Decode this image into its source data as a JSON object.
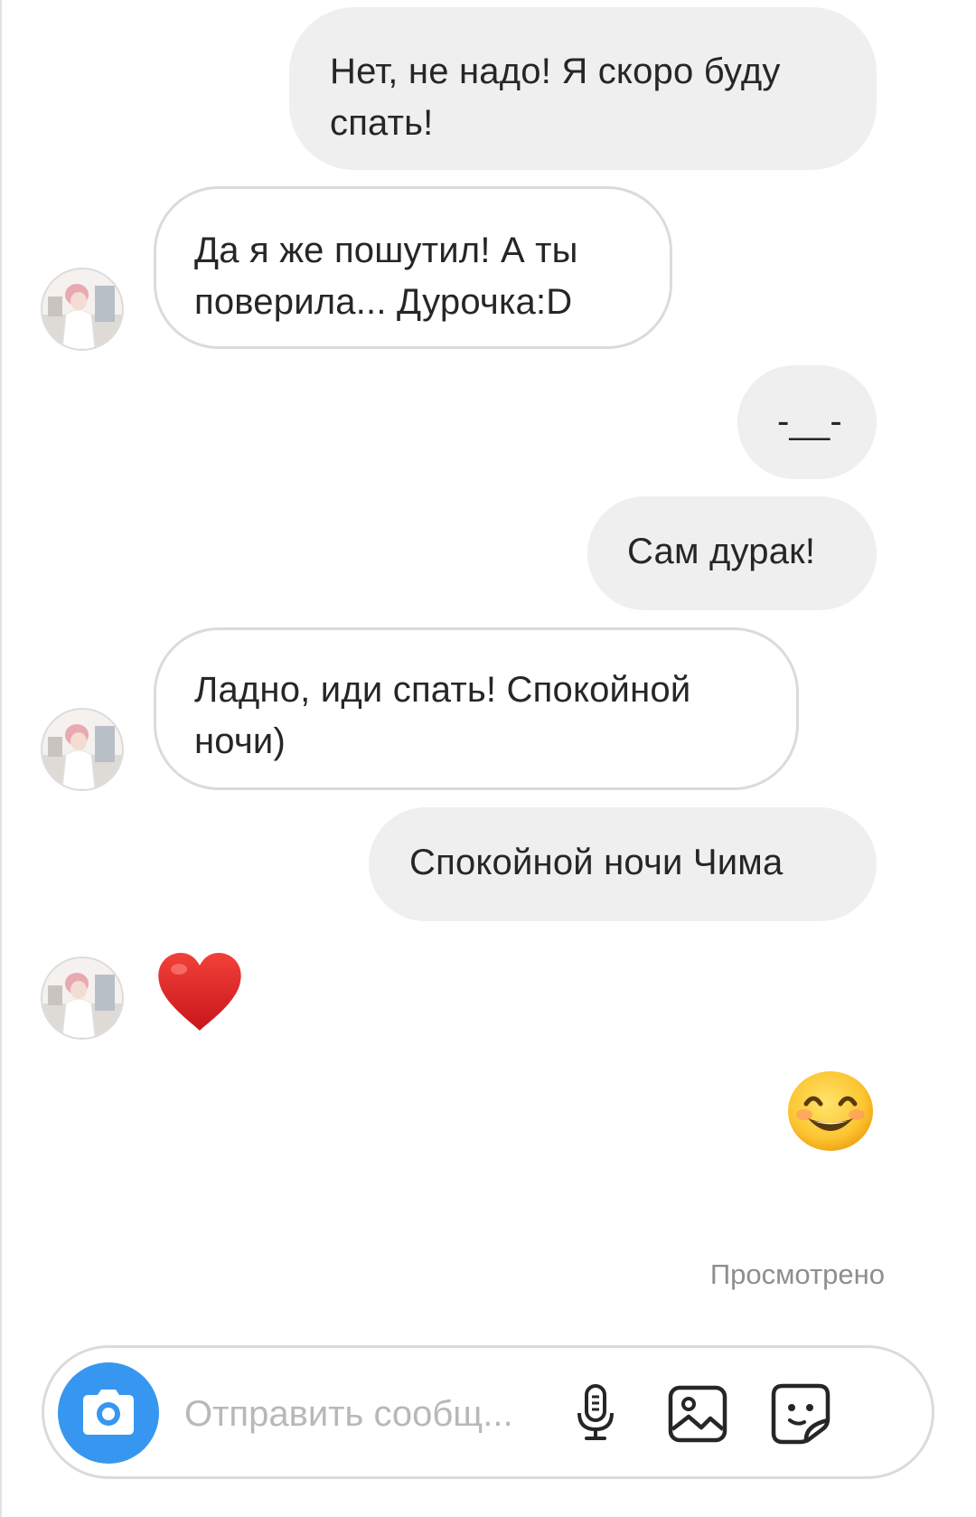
{
  "messages": [
    {
      "side": "sent",
      "text": "Нет, не надо! Я скоро буду спать!"
    },
    {
      "side": "received",
      "text": "Да я же пошутил! А ты поверила... Дурочка:D"
    },
    {
      "side": "sent",
      "text": "-__-"
    },
    {
      "side": "sent",
      "text": "Сам дурак!"
    },
    {
      "side": "received",
      "text": "Ладно, иди спать! Спокойной ночи)"
    },
    {
      "side": "sent",
      "text": "Спокойной ночи Чима"
    },
    {
      "side": "received",
      "emoji": "heart-emoji"
    },
    {
      "side": "sent",
      "emoji": "smiling-face-emoji"
    }
  ],
  "status": {
    "seen_label": "Просмотрено"
  },
  "composer": {
    "placeholder": "Отправить сообщ...",
    "camera_icon": "camera-icon",
    "mic_icon": "microphone-icon",
    "gallery_icon": "gallery-icon",
    "sticker_icon": "sticker-icon"
  },
  "colors": {
    "sent_bubble": "#efefef",
    "received_border": "#dbdbdb",
    "camera_button": "#3797f0",
    "seen_text": "#8e8e8e",
    "placeholder_text": "#b8b8b8",
    "heart": "#e0241f"
  }
}
